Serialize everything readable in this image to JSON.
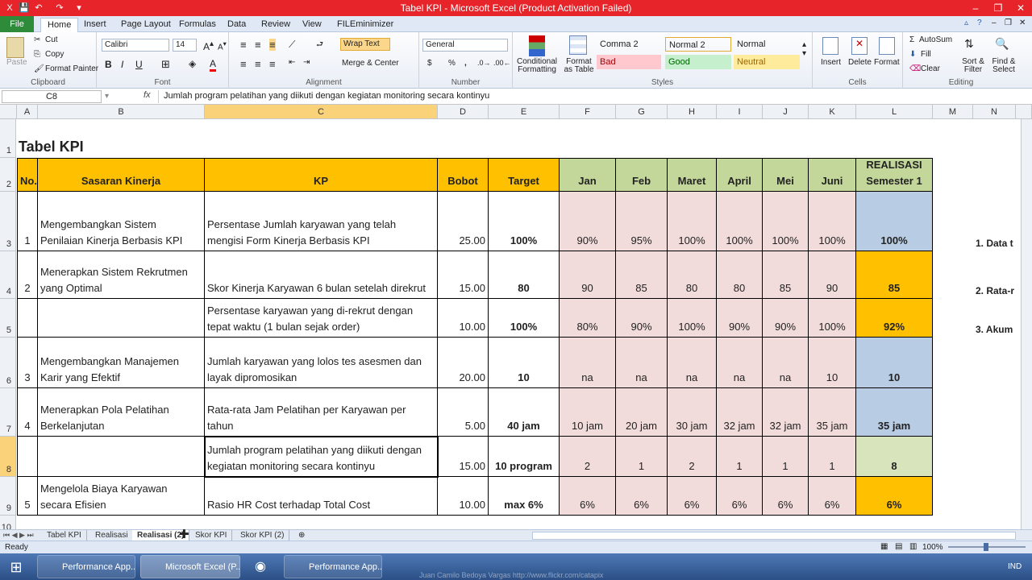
{
  "window": {
    "title": "Tabel KPI  -  Microsoft Excel (Product Activation Failed)"
  },
  "ribbon_tabs": [
    "File",
    "Home",
    "Insert",
    "Page Layout",
    "Formulas",
    "Data",
    "Review",
    "View",
    "FILEminimizer"
  ],
  "ribbon": {
    "clipboard": {
      "label": "Clipboard",
      "paste": "Paste",
      "cut": "Cut",
      "copy": "Copy",
      "format_painter": "Format Painter"
    },
    "font": {
      "label": "Font",
      "name": "Calibri",
      "size": "14"
    },
    "alignment": {
      "label": "Alignment",
      "wrap_text": "Wrap Text",
      "merge": "Merge & Center"
    },
    "number": {
      "label": "Number",
      "format": "General"
    },
    "styles": {
      "label": "Styles",
      "conditional": "Conditional Formatting",
      "format_table": "Format as Table",
      "cells": [
        {
          "name": "Comma 2",
          "bg": "#ffffff"
        },
        {
          "name": "Normal 2",
          "bg": "#ffffff"
        },
        {
          "name": "Normal",
          "bg": "#ffffff"
        },
        {
          "name": "Bad",
          "bg": "#ffc7ce"
        },
        {
          "name": "Good",
          "bg": "#c6efce"
        },
        {
          "name": "Neutral",
          "bg": "#ffeb9c"
        }
      ]
    },
    "cells": {
      "label": "Cells",
      "insert": "Insert",
      "delete": "Delete",
      "format": "Format"
    },
    "editing": {
      "label": "Editing",
      "autosum": "AutoSum",
      "fill": "Fill",
      "clear": "Clear",
      "sort": "Sort & Filter",
      "find": "Find & Select"
    }
  },
  "formula_bar": {
    "name_box": "C8",
    "fx": "fx",
    "content": "Jumlah program pelatihan yang diikuti dengan kegiatan monitoring secara kontinyu"
  },
  "columns": [
    "A",
    "B",
    "C",
    "D",
    "E",
    "F",
    "G",
    "H",
    "I",
    "J",
    "K",
    "L",
    "M",
    "N"
  ],
  "rows": [
    "1",
    "2",
    "3",
    "4",
    "5",
    "6",
    "7",
    "8",
    "9",
    "10"
  ],
  "sheet": {
    "title": "Tabel KPI",
    "headers": {
      "no": "No.",
      "sasaran": "Sasaran Kinerja",
      "kp": "KP",
      "bobot": "Bobot",
      "target": "Target",
      "jan": "Jan",
      "feb": "Feb",
      "mar": "Maret",
      "apr": "April",
      "mei": "Mei",
      "jun": "Juni",
      "real1": "REALISASI",
      "real2": "Semester 1"
    },
    "data": [
      {
        "no": "1",
        "sasaran": "Mengembangkan Sistem Penilaian Kinerja Berbasis KPI",
        "kp": "Persentase Jumlah karyawan yang telah mengisi Form Kinerja Berbasis KPI",
        "bobot": "25.00",
        "target": "100%",
        "m": [
          "90%",
          "95%",
          "100%",
          "100%",
          "100%",
          "100%"
        ],
        "real": "100%",
        "rc": "blue"
      },
      {
        "no": "2",
        "sasaran": "Menerapkan Sistem Rekrutmen yang Optimal",
        "kp": "Skor Kinerja Karyawan 6 bulan setelah direkrut",
        "bobot": "15.00",
        "target": "80",
        "m": [
          "90",
          "85",
          "80",
          "80",
          "85",
          "90"
        ],
        "real": "85",
        "rc": "orange"
      },
      {
        "no": "",
        "sasaran": "",
        "kp": "Persentase karyawan yang di-rekrut dengan tepat waktu (1 bulan sejak order)",
        "bobot": "10.00",
        "target": "100%",
        "m": [
          "80%",
          "90%",
          "100%",
          "90%",
          "90%",
          "100%"
        ],
        "real": "92%",
        "rc": "orange"
      },
      {
        "no": "3",
        "sasaran": "Mengembangkan Manajemen Karir yang Efektif",
        "kp": "Jumlah karyawan yang lolos tes asesmen dan layak dipromosikan",
        "bobot": "20.00",
        "target": "10",
        "m": [
          "na",
          "na",
          "na",
          "na",
          "na",
          "10"
        ],
        "real": "10",
        "rc": "blue"
      },
      {
        "no": "4",
        "sasaran": "Menerapkan Pola Pelatihan Berkelanjutan",
        "kp": "Rata-rata Jam Pelatihan per Karyawan per tahun",
        "bobot": "5.00",
        "target": "40 jam",
        "m": [
          "10 jam",
          "20 jam",
          "30 jam",
          "32 jam",
          "32 jam",
          "35 jam"
        ],
        "real": "35 jam",
        "rc": "blue"
      },
      {
        "no": "",
        "sasaran": "",
        "kp": "Jumlah program pelatihan yang diikuti dengan kegiatan monitoring secara kontinyu",
        "bobot": "15.00",
        "target": "10 program",
        "m": [
          "2",
          "1",
          "2",
          "1",
          "1",
          "1"
        ],
        "real": "8",
        "rc": "lgreen"
      },
      {
        "no": "5",
        "sasaran": "Mengelola Biaya Karyawan secara Efisien",
        "kp": "Rasio HR Cost terhadap Total Cost",
        "bobot": "10.00",
        "target": "max 6%",
        "m": [
          "6%",
          "6%",
          "6%",
          "6%",
          "6%",
          "6%"
        ],
        "real": "6%",
        "rc": "orange"
      }
    ],
    "side_notes": [
      "1. Data t",
      "2. Rata-r",
      "3. Akum"
    ]
  },
  "sheet_tabs": [
    "Tabel KPI",
    "Realisasi",
    "Realisasi (2)",
    "Skor KPI",
    "Skor KPI (2)"
  ],
  "status": {
    "ready": "Ready",
    "zoom": "100%"
  },
  "taskbar": {
    "items": [
      "Performance App...",
      "Microsoft Excel (P...",
      "Performance App..."
    ],
    "lang": "IND",
    "watermark": "Juan Camilo Bedoya Vargas  http://www.flickr.com/catapix"
  }
}
